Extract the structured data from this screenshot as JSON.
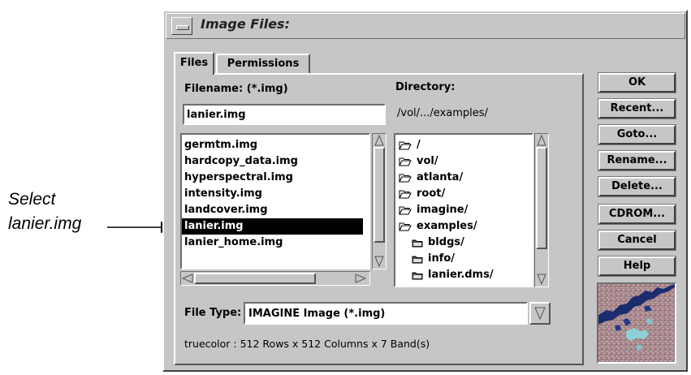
{
  "callout": {
    "line1": "Select",
    "line2": "lanier.img"
  },
  "window": {
    "title": "Image Files:"
  },
  "tabs": [
    {
      "label": "Files"
    },
    {
      "label": "Permissions"
    }
  ],
  "filename": {
    "label": "Filename: (*.img)",
    "value": "lanier.img"
  },
  "directory": {
    "label": "Directory:",
    "path": "/vol/.../examples/"
  },
  "files": [
    {
      "name": "germtm.img"
    },
    {
      "name": "hardcopy_data.img"
    },
    {
      "name": "hyperspectral.img"
    },
    {
      "name": "intensity.img"
    },
    {
      "name": "landcover.img"
    },
    {
      "name": "lanier.img",
      "selected": true
    },
    {
      "name": "lanier_home.img"
    }
  ],
  "dirs": [
    {
      "name": "/",
      "icon": "open-folder-icon"
    },
    {
      "name": "vol/",
      "icon": "open-folder-icon"
    },
    {
      "name": "atlanta/",
      "icon": "open-folder-icon"
    },
    {
      "name": "root/",
      "icon": "open-folder-icon"
    },
    {
      "name": "imagine/",
      "icon": "open-folder-icon"
    },
    {
      "name": "examples/",
      "icon": "open-folder-icon"
    },
    {
      "name": "bldgs/",
      "icon": "closed-folder-icon"
    },
    {
      "name": "info/",
      "icon": "closed-folder-icon"
    },
    {
      "name": "lanier.dms/",
      "icon": "closed-folder-icon"
    }
  ],
  "filetype": {
    "label": "File Type:",
    "value": "IMAGINE Image (*.img)"
  },
  "info": "truecolor : 512 Rows x 512 Columns x 7 Band(s)",
  "buttons": {
    "ok": "OK",
    "recent": "Recent...",
    "goto": "Goto...",
    "rename": "Rename...",
    "delete": "Delete...",
    "cdrom": "CDROM...",
    "cancel": "Cancel",
    "help": "Help"
  }
}
